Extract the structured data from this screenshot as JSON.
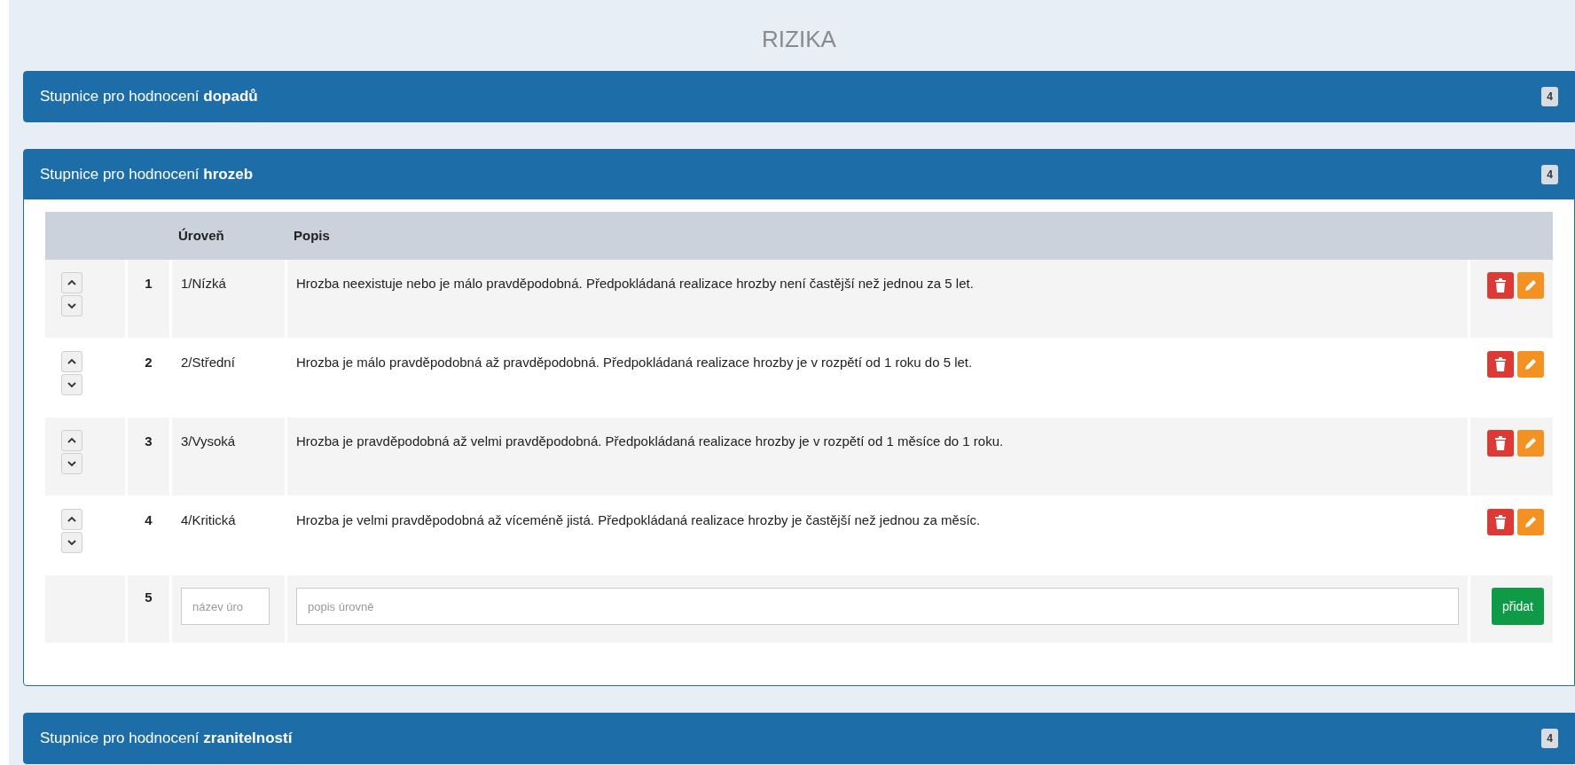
{
  "page_title": "RIZIKA",
  "panels": [
    {
      "title": "Stupnice pro hodnocení **dopadů**",
      "badge": "4"
    },
    {
      "title": "Stupnice pro hodnocení **hrozeb**",
      "badge": "4",
      "table": {
        "columns": [
          "Úroveň",
          "Popis"
        ],
        "rows": [
          {
            "number": "1",
            "level": "1/Nízká",
            "description": "Hrozba neexistuje nebo je málo pravděpodobná. Předpokládaná realizace hrozby není častější než jednou za 5 let."
          },
          {
            "number": "2",
            "level": "2/Střední",
            "description": "Hrozba je málo pravděpodobná až pravděpodobná. Předpokládaná realizace hrozby je v rozpětí od 1 roku do 5 let."
          },
          {
            "number": "3",
            "level": "3/Vysoká",
            "description": "Hrozba je pravděpodobná až velmi pravděpodobná. Předpokládaná realizace hrozby je v rozpětí od 1 měsíce do 1 roku."
          },
          {
            "number": "4",
            "level": "4/Kritická",
            "description": "Hrozba je velmi pravděpodobná až víceméně jistá. Předpokládaná realizace hrozby je častější než jednou za měsíc."
          }
        ],
        "new_row": {
          "number": "5",
          "name_placeholder": "název úro",
          "description_placeholder": "popis úrovně",
          "add_button": "přidat"
        }
      }
    },
    {
      "title": "Stupnice pro hodnocení **zranitelností**",
      "badge": "4"
    }
  ]
}
